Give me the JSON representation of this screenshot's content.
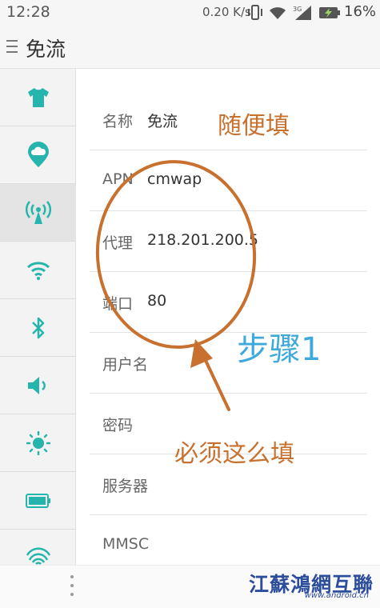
{
  "status_bar": {
    "time": "12:28",
    "speed": "0.20 K/s",
    "network": "3G",
    "battery": "16%"
  },
  "header": {
    "title": "免流"
  },
  "sidebar": {
    "items": [
      {
        "icon": "theme-shirt-icon"
      },
      {
        "icon": "cloud-icon"
      },
      {
        "icon": "antenna-icon",
        "active": true
      },
      {
        "icon": "wifi-icon"
      },
      {
        "icon": "bluetooth-icon"
      },
      {
        "icon": "speaker-icon"
      },
      {
        "icon": "brightness-icon"
      },
      {
        "icon": "battery-icon"
      },
      {
        "icon": "fingerprint-icon"
      }
    ]
  },
  "apn_form": {
    "name": {
      "label": "名称",
      "value": "免流"
    },
    "apn": {
      "label": "APN",
      "value": "cmwap"
    },
    "proxy": {
      "label": "代理",
      "value": "218.201.200.5"
    },
    "port": {
      "label": "端口",
      "value": "80"
    },
    "username": {
      "label": "用户名",
      "value": ""
    },
    "password": {
      "label": "密码",
      "value": ""
    },
    "server": {
      "label": "服务器",
      "value": ""
    },
    "mmsc": {
      "label": "MMSC",
      "value": ""
    }
  },
  "annotations": {
    "fill_anything": "随便填",
    "step": "步骤1",
    "must_fill": "必须这么填"
  },
  "watermark": {
    "main": "江蘇鴻網互聯",
    "sub": "www.android.cn"
  },
  "colors": {
    "accent": "#26b5ad",
    "annotation_orange": "#c8702e",
    "annotation_blue": "#3ea9db"
  }
}
